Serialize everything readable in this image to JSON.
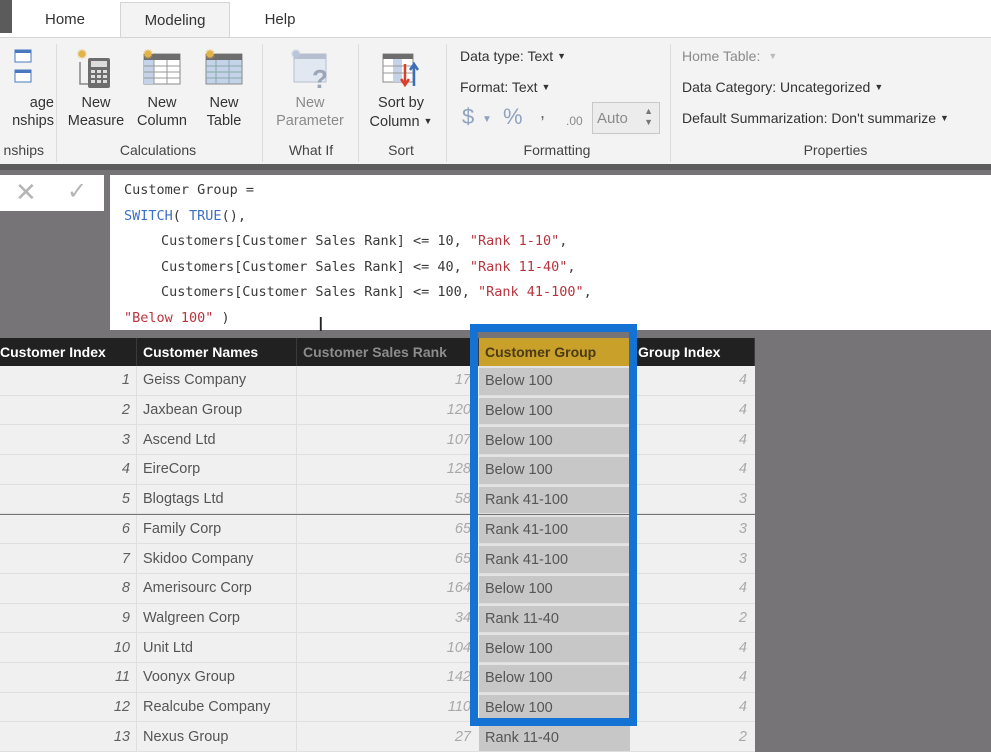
{
  "tabs": [
    {
      "label": "Home",
      "active": false
    },
    {
      "label": "Modeling",
      "active": true
    },
    {
      "label": "Help",
      "active": false
    }
  ],
  "ribbon": {
    "relationships": {
      "button_label_1": "age",
      "button_label_2": "nships",
      "group_label": "nships"
    },
    "calculations": {
      "group_label": "Calculations",
      "new_measure": {
        "line1": "New",
        "line2": "Measure"
      },
      "new_column": {
        "line1": "New",
        "line2": "Column"
      },
      "new_table": {
        "line1": "New",
        "line2": "Table"
      }
    },
    "what_if": {
      "group_label": "What If",
      "new_parameter": {
        "line1": "New",
        "line2": "Parameter"
      }
    },
    "sort": {
      "group_label": "Sort",
      "sort_by_column": {
        "line1": "Sort by",
        "line2": "Column"
      }
    },
    "formatting": {
      "group_label": "Formatting",
      "data_type": "Data type: Text",
      "format": "Format: Text",
      "currency_symbol": "$",
      "percent_symbol": "%",
      "comma_symbol": ",",
      "decimal_symbol": ".00",
      "decimal_places": "Auto"
    },
    "properties": {
      "group_label": "Properties",
      "home_table": "Home Table:",
      "data_category": "Data Category: Uncategorized",
      "default_summarization": "Default Summarization: Don't summarize"
    }
  },
  "formula_bar": {
    "cancel_icon": "close-icon",
    "commit_icon": "checkmark-icon",
    "line1": "Customer Group =",
    "line2_kw1": "SWITCH",
    "line2_mid": "( ",
    "line2_kw2": "TRUE",
    "line2_end": "(),",
    "conditions": [
      {
        "expr": "Customers[Customer Sales Rank] <= 10, ",
        "result": "\"Rank 1-10\"",
        "tail": ","
      },
      {
        "expr": "Customers[Customer Sales Rank] <= 40, ",
        "result": "\"Rank 11-40\"",
        "tail": ","
      },
      {
        "expr": "Customers[Customer Sales Rank] <= 100, ",
        "result": "\"Rank 41-100\"",
        "tail": ","
      }
    ],
    "else_value": "\"Below 100\"",
    "close": " )"
  },
  "table": {
    "columns": [
      "Customer Index",
      "Customer Names",
      "Customer Sales Rank",
      "Customer Group",
      "Group Index"
    ],
    "selected_column": "Customer Group",
    "rows": [
      {
        "index": "1",
        "name": "Geiss Company",
        "rank": "17",
        "group": "Below 100",
        "group_index": "4"
      },
      {
        "index": "2",
        "name": "Jaxbean Group",
        "rank": "120",
        "group": "Below 100",
        "group_index": "4"
      },
      {
        "index": "3",
        "name": "Ascend Ltd",
        "rank": "107",
        "group": "Below 100",
        "group_index": "4"
      },
      {
        "index": "4",
        "name": "EireCorp",
        "rank": "128",
        "group": "Below 100",
        "group_index": "4"
      },
      {
        "index": "5",
        "name": "Blogtags Ltd",
        "rank": "58",
        "group": "Rank 41-100",
        "group_index": "3"
      },
      {
        "index": "6",
        "name": "Family Corp",
        "rank": "65",
        "group": "Rank 41-100",
        "group_index": "3"
      },
      {
        "index": "7",
        "name": "Skidoo Company",
        "rank": "65",
        "group": "Rank 41-100",
        "group_index": "3"
      },
      {
        "index": "8",
        "name": "Amerisourc Corp",
        "rank": "164",
        "group": "Below 100",
        "group_index": "4"
      },
      {
        "index": "9",
        "name": "Walgreen Corp",
        "rank": "34",
        "group": "Rank 11-40",
        "group_index": "2"
      },
      {
        "index": "10",
        "name": "Unit Ltd",
        "rank": "104",
        "group": "Below 100",
        "group_index": "4"
      },
      {
        "index": "11",
        "name": "Voonyx Group",
        "rank": "142",
        "group": "Below 100",
        "group_index": "4"
      },
      {
        "index": "12",
        "name": "Realcube Company",
        "rank": "110",
        "group": "Below 100",
        "group_index": "4"
      },
      {
        "index": "13",
        "name": "Nexus Group",
        "rank": "27",
        "group": "Rank 11-40",
        "group_index": "2"
      }
    ]
  },
  "colors": {
    "selected_header": "#c9a02a",
    "highlight_border": "#1372d3",
    "dax_keyword": "#3c6fc6",
    "dax_string": "#b8343f"
  }
}
